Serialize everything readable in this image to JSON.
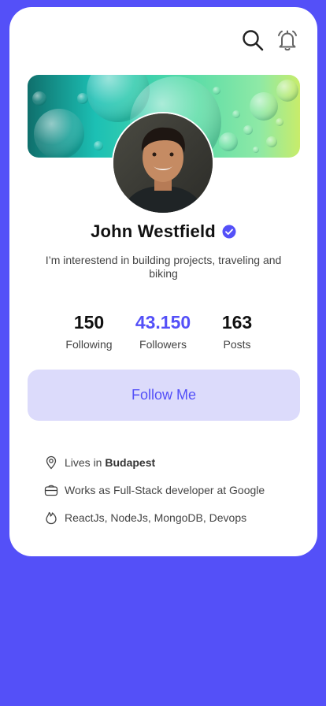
{
  "header": {
    "search_icon": "search-icon",
    "bell_icon": "bell-icon"
  },
  "profile": {
    "name": "John Westfield",
    "verified_icon": "verified-badge-icon",
    "bio": "I’m interestend in building projects, traveling and biking"
  },
  "stats": [
    {
      "value": "150",
      "label": "Following"
    },
    {
      "value": "43.150",
      "label": "Followers"
    },
    {
      "value": "163",
      "label": "Posts"
    }
  ],
  "follow_button": {
    "label": "Follow Me"
  },
  "info": {
    "location_prefix": "Lives in ",
    "location_city": "Budapest",
    "work": "Works as Full-Stack developer at Google",
    "skills": "ReactJs, NodeJs, MongoDB, Devops"
  },
  "colors": {
    "accent": "#5450F8",
    "follow_bg": "#DCDBFB",
    "verified": "#5450F8"
  }
}
